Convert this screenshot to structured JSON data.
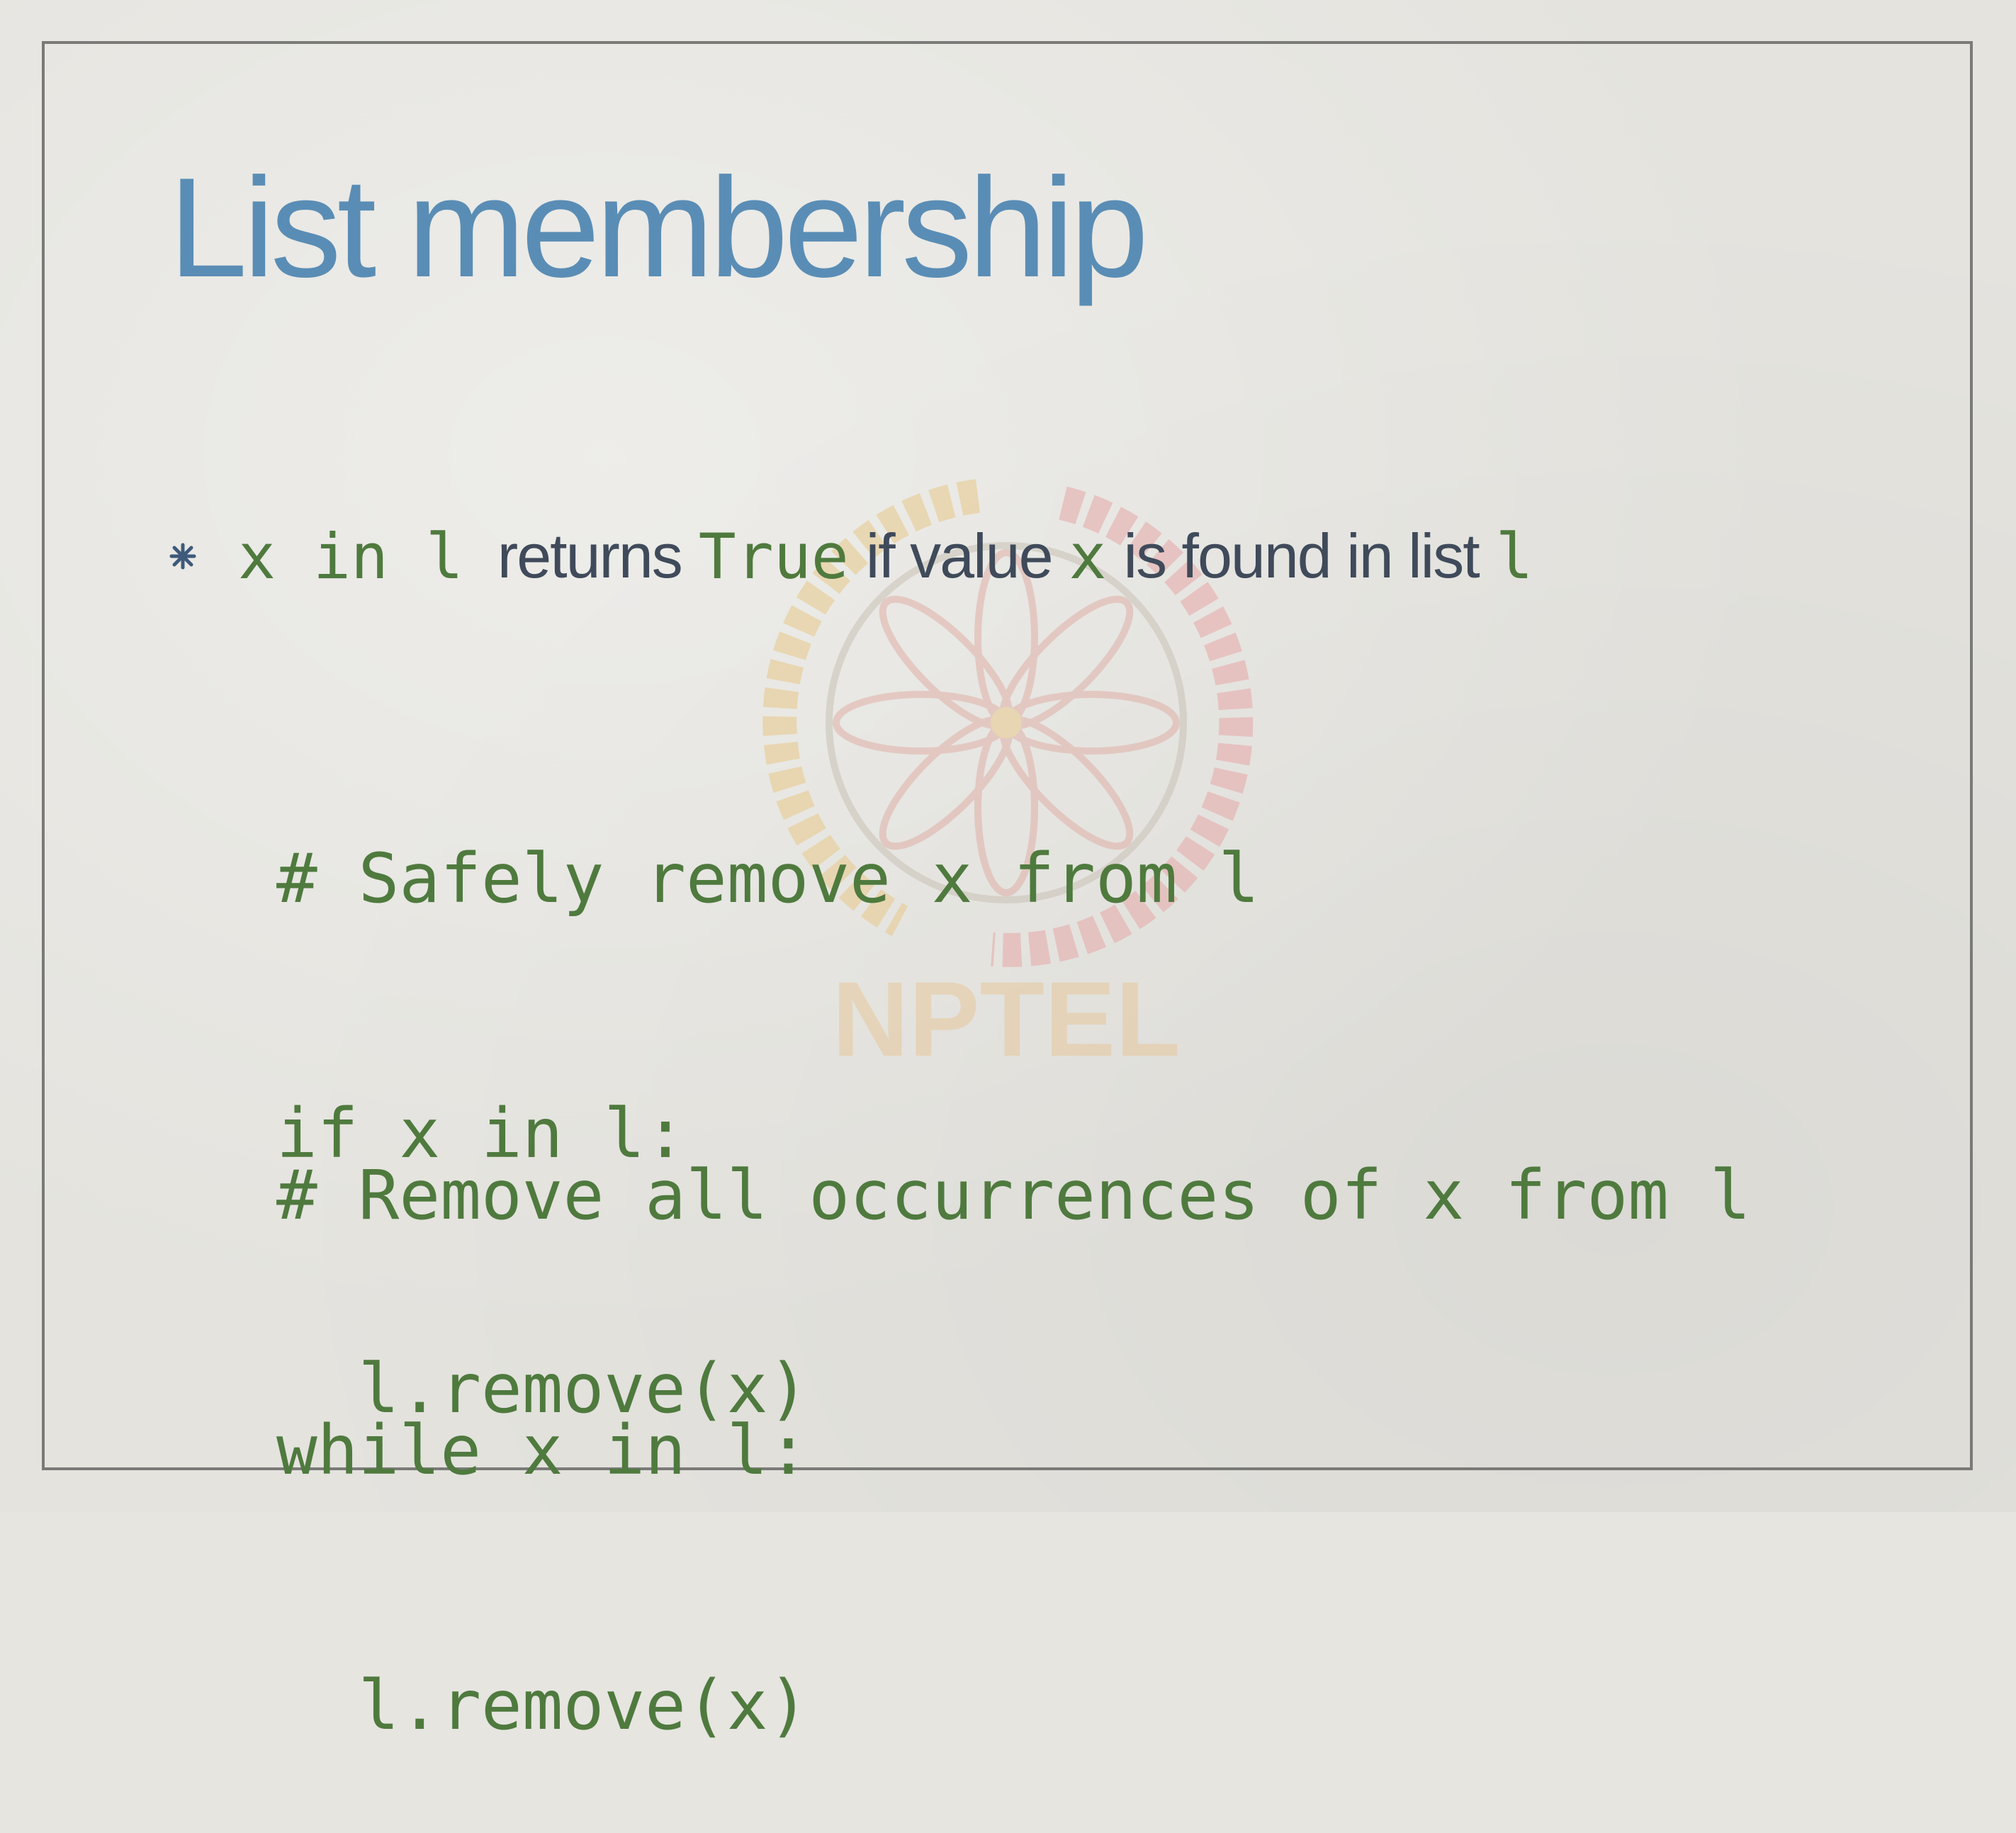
{
  "slide": {
    "title": "List membership",
    "bullet": {
      "code_expr": "x in l",
      "text_1": "returns",
      "code_true": "True",
      "text_2": "if value",
      "code_x": "x",
      "text_3": "is found in list",
      "code_l": "l"
    },
    "code_block_1": [
      "# Safely remove x from l",
      "if x in l:",
      "  l.remove(x)"
    ],
    "code_block_2": [
      "# Remove all occurrences of x from l",
      "while x in l:",
      "  l.remove(x)"
    ],
    "watermark": {
      "text": "NPTEL",
      "icon": "nptel-logo"
    }
  },
  "colors": {
    "title": "#5a8db5",
    "code": "#4f7a3e",
    "text": "#3f4a5a",
    "frame": "#7a7a78",
    "background": "#e4e3de"
  }
}
